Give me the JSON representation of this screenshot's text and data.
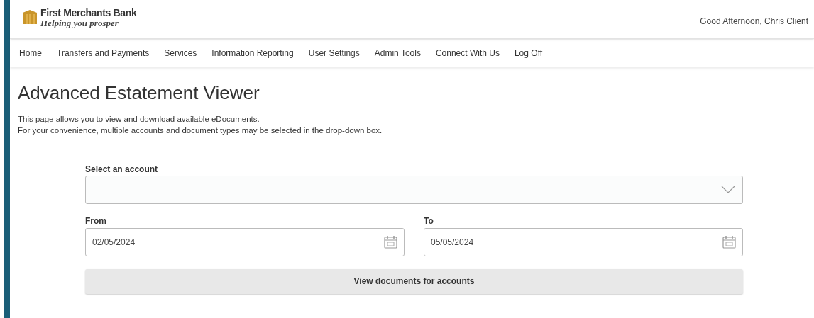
{
  "brand": {
    "name": "First Merchants Bank",
    "tagline": "Helping you prosper"
  },
  "greeting": "Good Afternoon, Chris Client",
  "nav": [
    {
      "label": "Home"
    },
    {
      "label": "Transfers and Payments"
    },
    {
      "label": "Services"
    },
    {
      "label": "Information Reporting"
    },
    {
      "label": "User Settings"
    },
    {
      "label": "Admin Tools"
    },
    {
      "label": "Connect With Us"
    },
    {
      "label": "Log Off"
    }
  ],
  "page": {
    "title": "Advanced Estatement Viewer",
    "intro": [
      "This page allows you to view and download available eDocuments.",
      "For your convenience, multiple accounts and document types may be selected in the drop-down box."
    ]
  },
  "form": {
    "account_label": "Select an account",
    "dates": [
      {
        "label": "From",
        "value": "02/05/2024"
      },
      {
        "label": "To",
        "value": "05/05/2024"
      }
    ],
    "button": "View documents for accounts"
  }
}
